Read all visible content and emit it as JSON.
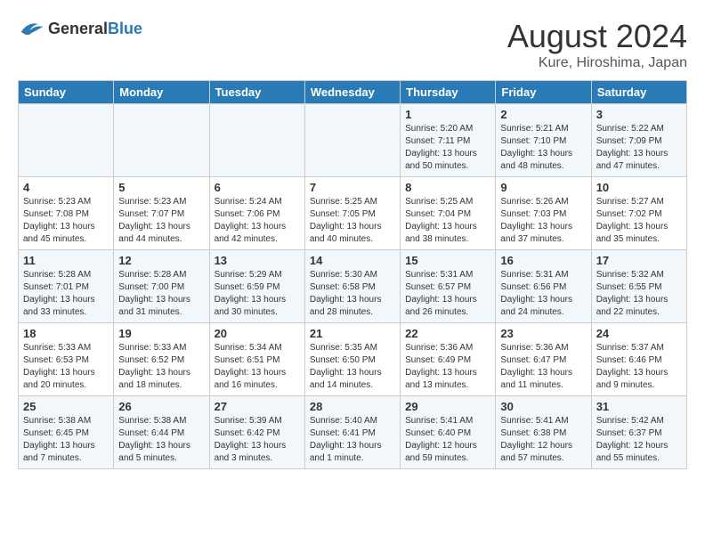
{
  "header": {
    "logo_general": "General",
    "logo_blue": "Blue",
    "main_title": "August 2024",
    "subtitle": "Kure, Hiroshima, Japan"
  },
  "weekdays": [
    "Sunday",
    "Monday",
    "Tuesday",
    "Wednesday",
    "Thursday",
    "Friday",
    "Saturday"
  ],
  "weeks": [
    [
      {
        "day": "",
        "info": ""
      },
      {
        "day": "",
        "info": ""
      },
      {
        "day": "",
        "info": ""
      },
      {
        "day": "",
        "info": ""
      },
      {
        "day": "1",
        "info": "Sunrise: 5:20 AM\nSunset: 7:11 PM\nDaylight: 13 hours\nand 50 minutes."
      },
      {
        "day": "2",
        "info": "Sunrise: 5:21 AM\nSunset: 7:10 PM\nDaylight: 13 hours\nand 48 minutes."
      },
      {
        "day": "3",
        "info": "Sunrise: 5:22 AM\nSunset: 7:09 PM\nDaylight: 13 hours\nand 47 minutes."
      }
    ],
    [
      {
        "day": "4",
        "info": "Sunrise: 5:23 AM\nSunset: 7:08 PM\nDaylight: 13 hours\nand 45 minutes."
      },
      {
        "day": "5",
        "info": "Sunrise: 5:23 AM\nSunset: 7:07 PM\nDaylight: 13 hours\nand 44 minutes."
      },
      {
        "day": "6",
        "info": "Sunrise: 5:24 AM\nSunset: 7:06 PM\nDaylight: 13 hours\nand 42 minutes."
      },
      {
        "day": "7",
        "info": "Sunrise: 5:25 AM\nSunset: 7:05 PM\nDaylight: 13 hours\nand 40 minutes."
      },
      {
        "day": "8",
        "info": "Sunrise: 5:25 AM\nSunset: 7:04 PM\nDaylight: 13 hours\nand 38 minutes."
      },
      {
        "day": "9",
        "info": "Sunrise: 5:26 AM\nSunset: 7:03 PM\nDaylight: 13 hours\nand 37 minutes."
      },
      {
        "day": "10",
        "info": "Sunrise: 5:27 AM\nSunset: 7:02 PM\nDaylight: 13 hours\nand 35 minutes."
      }
    ],
    [
      {
        "day": "11",
        "info": "Sunrise: 5:28 AM\nSunset: 7:01 PM\nDaylight: 13 hours\nand 33 minutes."
      },
      {
        "day": "12",
        "info": "Sunrise: 5:28 AM\nSunset: 7:00 PM\nDaylight: 13 hours\nand 31 minutes."
      },
      {
        "day": "13",
        "info": "Sunrise: 5:29 AM\nSunset: 6:59 PM\nDaylight: 13 hours\nand 30 minutes."
      },
      {
        "day": "14",
        "info": "Sunrise: 5:30 AM\nSunset: 6:58 PM\nDaylight: 13 hours\nand 28 minutes."
      },
      {
        "day": "15",
        "info": "Sunrise: 5:31 AM\nSunset: 6:57 PM\nDaylight: 13 hours\nand 26 minutes."
      },
      {
        "day": "16",
        "info": "Sunrise: 5:31 AM\nSunset: 6:56 PM\nDaylight: 13 hours\nand 24 minutes."
      },
      {
        "day": "17",
        "info": "Sunrise: 5:32 AM\nSunset: 6:55 PM\nDaylight: 13 hours\nand 22 minutes."
      }
    ],
    [
      {
        "day": "18",
        "info": "Sunrise: 5:33 AM\nSunset: 6:53 PM\nDaylight: 13 hours\nand 20 minutes."
      },
      {
        "day": "19",
        "info": "Sunrise: 5:33 AM\nSunset: 6:52 PM\nDaylight: 13 hours\nand 18 minutes."
      },
      {
        "day": "20",
        "info": "Sunrise: 5:34 AM\nSunset: 6:51 PM\nDaylight: 13 hours\nand 16 minutes."
      },
      {
        "day": "21",
        "info": "Sunrise: 5:35 AM\nSunset: 6:50 PM\nDaylight: 13 hours\nand 14 minutes."
      },
      {
        "day": "22",
        "info": "Sunrise: 5:36 AM\nSunset: 6:49 PM\nDaylight: 13 hours\nand 13 minutes."
      },
      {
        "day": "23",
        "info": "Sunrise: 5:36 AM\nSunset: 6:47 PM\nDaylight: 13 hours\nand 11 minutes."
      },
      {
        "day": "24",
        "info": "Sunrise: 5:37 AM\nSunset: 6:46 PM\nDaylight: 13 hours\nand 9 minutes."
      }
    ],
    [
      {
        "day": "25",
        "info": "Sunrise: 5:38 AM\nSunset: 6:45 PM\nDaylight: 13 hours\nand 7 minutes."
      },
      {
        "day": "26",
        "info": "Sunrise: 5:38 AM\nSunset: 6:44 PM\nDaylight: 13 hours\nand 5 minutes."
      },
      {
        "day": "27",
        "info": "Sunrise: 5:39 AM\nSunset: 6:42 PM\nDaylight: 13 hours\nand 3 minutes."
      },
      {
        "day": "28",
        "info": "Sunrise: 5:40 AM\nSunset: 6:41 PM\nDaylight: 13 hours\nand 1 minute."
      },
      {
        "day": "29",
        "info": "Sunrise: 5:41 AM\nSunset: 6:40 PM\nDaylight: 12 hours\nand 59 minutes."
      },
      {
        "day": "30",
        "info": "Sunrise: 5:41 AM\nSunset: 6:38 PM\nDaylight: 12 hours\nand 57 minutes."
      },
      {
        "day": "31",
        "info": "Sunrise: 5:42 AM\nSunset: 6:37 PM\nDaylight: 12 hours\nand 55 minutes."
      }
    ]
  ]
}
